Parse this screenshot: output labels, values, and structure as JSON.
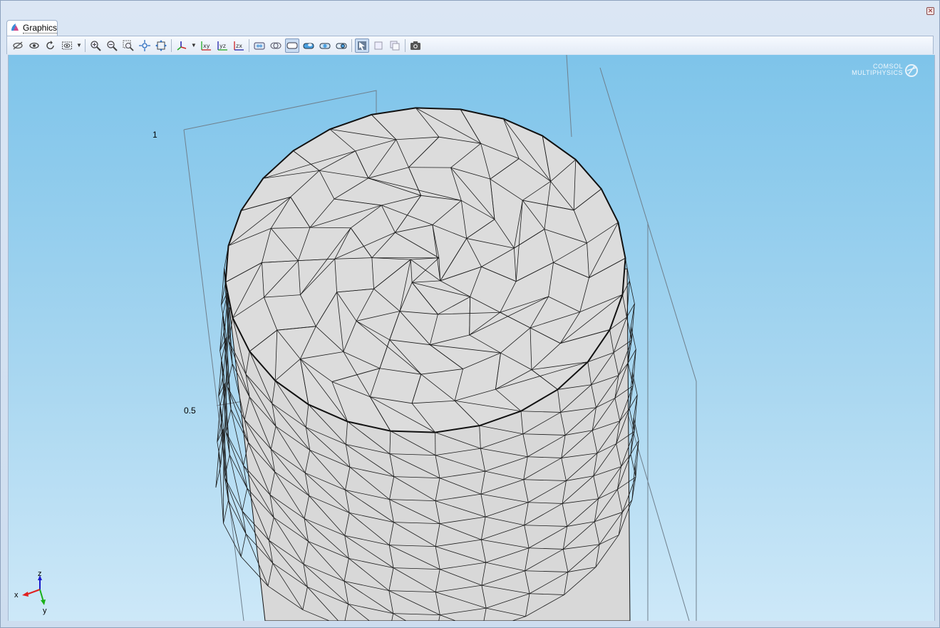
{
  "window": {
    "close_glyph": "✕"
  },
  "tab": {
    "label": "Graphics",
    "icon": "graphics-window-icon"
  },
  "toolbar": {
    "groups": [
      [
        "hide-icon",
        "show-icon",
        "reset-hiding-icon",
        "view-selection-icon"
      ],
      [
        "zoom-in-icon",
        "zoom-out-icon",
        "zoom-box-icon",
        "zoom-selected-icon",
        "zoom-extents-icon"
      ],
      [
        "orthographic-axis-icon",
        "xy-plane-icon",
        "yz-plane-icon",
        "zx-plane-icon"
      ],
      [
        "scene-light-icon",
        "transparency-icon",
        "wireframe-icon",
        "render-1-icon",
        "render-2-icon",
        "render-3-icon"
      ],
      [
        "select-boxes-icon",
        "select-objects-icon",
        "select-domains-icon"
      ],
      [
        "image-snapshot-icon"
      ]
    ],
    "plane_labels": {
      "xy": "xy",
      "yz": "yz",
      "zx": "zx"
    }
  },
  "axes": {
    "tick_1": "1",
    "tick_05": "0.5"
  },
  "triad": {
    "z": "z",
    "x": "x",
    "y": "y"
  },
  "logo": {
    "line1": "COMSOL",
    "line2": "MULTIPHYSICS"
  },
  "colors": {
    "viewport_top": "#7ec4ea",
    "viewport_bottom": "#cde8f8",
    "mesh_fill": "#dcdcdc"
  }
}
